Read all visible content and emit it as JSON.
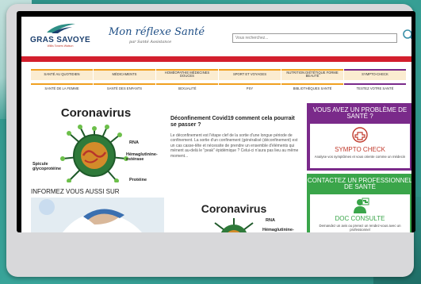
{
  "header": {
    "logo_name": "GRAS SAVOYE",
    "logo_tagline": "Willis Towers Watson",
    "slogan": "Mon réflexe Santé",
    "slogan_sub": "par Santé Assistance",
    "search_placeholder": "Vous recherchez..."
  },
  "nav": {
    "row1": [
      "SANTÉ AU QUOTIDIEN",
      "MÉDICAMENTS",
      "HOMÉOPATHIE MÉDECINES DOUCES",
      "SPORT ET VOYAGES",
      "NUTRITION DIÉTÉTIQUE FORME BEAUTÉ",
      "SYMPTO-CHECK"
    ],
    "row2": [
      "SANTÉ DE LA FEMME",
      "SANTÉ DES ENFANTS",
      "SEXUALITÉ",
      "PSY",
      "BIBLIOTHÈQUES SANTÉ",
      "TESTEZ VOTRE SANTÉ"
    ]
  },
  "article": {
    "image_title": "Coronavirus",
    "labels": {
      "rna": "RNA",
      "spicule": "Spicule glycoprotéine",
      "hema": "Hémaglutinine-estérase",
      "proteine": "Protéine"
    },
    "title": "Déconfinement Covid19 comment cela pourrait se passer ?",
    "text": "Le déconfinement est l'étape clef de la sortie d'une longue période de confinement. La sortie d'un confinement (généralisé (déconfinement) est un cas casse-tête et nécessite de prendre un ensemble d'éléments qui mènent au-delà le \"peak\" épidémique ? Celui-ci n'aura pas lieu au même moment..."
  },
  "informez": {
    "heading": "INFORMEZ VOUS AUSSI SUR",
    "card_title": "Coronavirus",
    "labels": {
      "rna": "RNA",
      "hema": "Hémaglutinine-"
    }
  },
  "sidebar": {
    "box1": {
      "heading": "VOUS AVEZ UN PROBLÈME DE SANTÉ ?",
      "label": "SYMPTO CHECK",
      "desc": "Analyse vos symptômes et vous oriente comme un médecin"
    },
    "box2": {
      "heading": "CONTACTEZ UN PROFESSIONNEL DE SANTÉ",
      "label": "DOC CONSULTE",
      "desc": "Demandez un avis ou prenez un rendez-vous avec un professionnel"
    }
  },
  "colors": {
    "brand_red": "#d31f2d",
    "purple": "#7a2a8a",
    "green": "#3aa54a",
    "orange": "#f0a020"
  }
}
